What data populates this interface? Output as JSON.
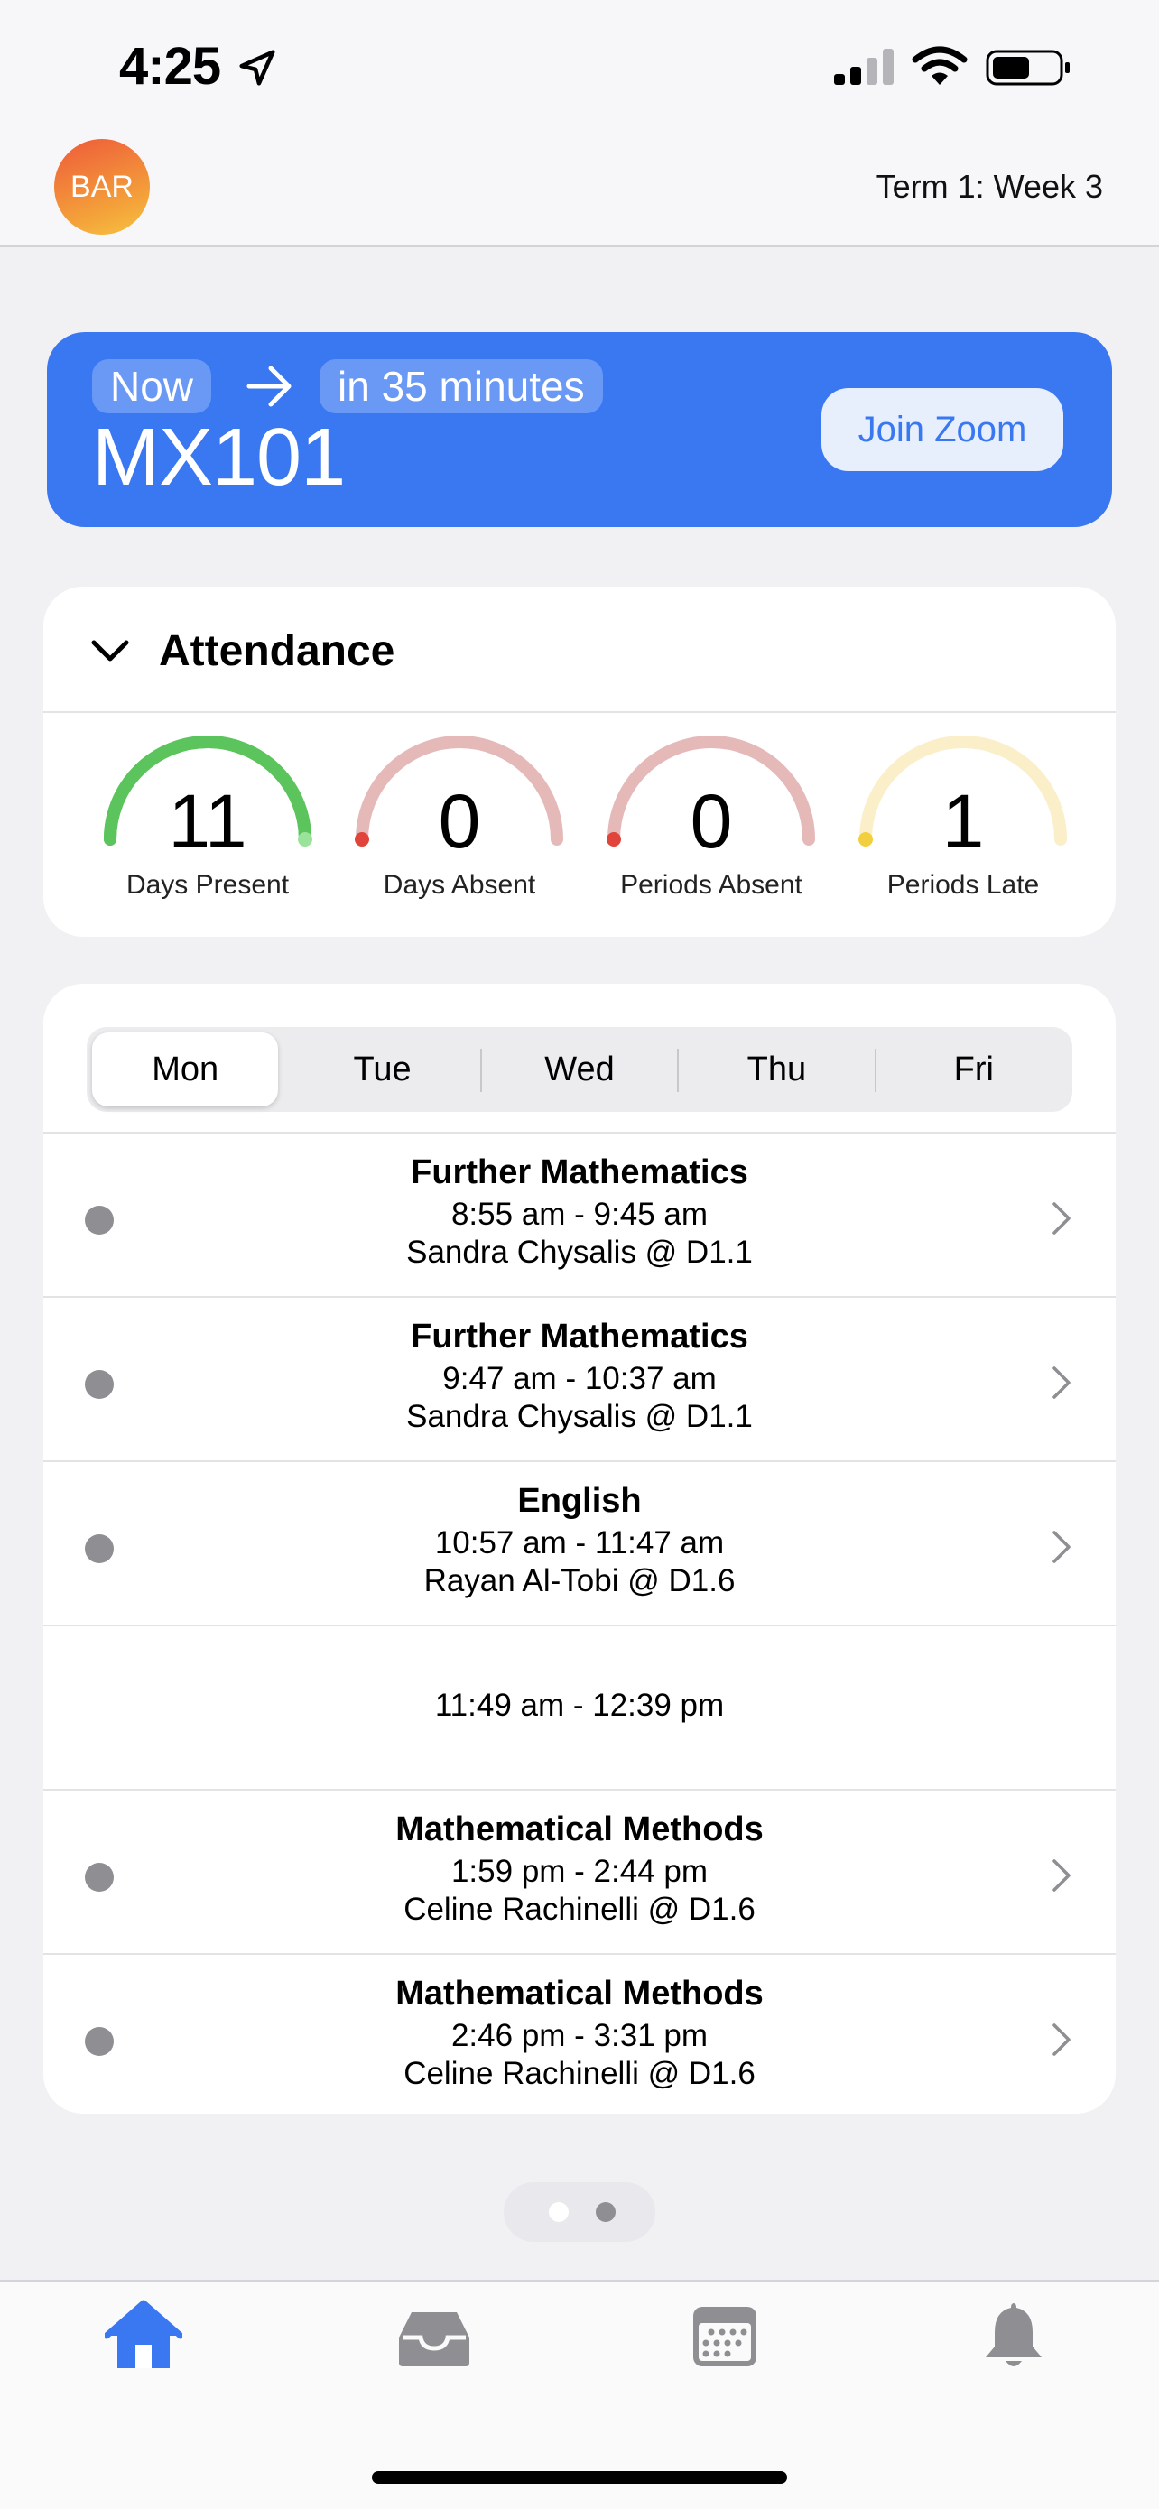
{
  "status_bar": {
    "time": "4:25"
  },
  "header": {
    "avatar_initials": "BAR",
    "term_label": "Term 1: Week 3"
  },
  "now_card": {
    "now_label": "Now",
    "next_label": "in 35 minutes",
    "course_code": "MX101",
    "join_button": "Join Zoom",
    "color": "#3a78f2"
  },
  "attendance": {
    "title": "Attendance",
    "stats": [
      {
        "value": "11",
        "label": "Days Present",
        "fill": 1.0,
        "color": "#5cc45c",
        "track": "#5cc45c"
      },
      {
        "value": "0",
        "label": "Days Absent",
        "fill": 0.0,
        "color": "#e0443a",
        "track": "#e6b9b9"
      },
      {
        "value": "0",
        "label": "Periods Absent",
        "fill": 0.0,
        "color": "#e0443a",
        "track": "#e6b9b9"
      },
      {
        "value": "1",
        "label": "Periods Late",
        "fill": 0.0,
        "color": "#f2cf3f",
        "track": "#fbefc9"
      }
    ]
  },
  "schedule": {
    "days": [
      "Mon",
      "Tue",
      "Wed",
      "Thu",
      "Fri"
    ],
    "selected_day": "Mon",
    "periods": [
      {
        "subject": "Further Mathematics",
        "time": "8:55 am - 9:45 am",
        "teacher_room": "Sandra Chysalis @ D1.1"
      },
      {
        "subject": "Further Mathematics",
        "time": "9:47 am - 10:37 am",
        "teacher_room": "Sandra Chysalis @ D1.1"
      },
      {
        "subject": "English",
        "time": "10:57 am - 11:47 am",
        "teacher_room": "Rayan Al-Tobi @ D1.6"
      },
      {
        "subject": "",
        "time": "11:49 am - 12:39 pm",
        "teacher_room": ""
      },
      {
        "subject": "Mathematical Methods",
        "time": "1:59 pm - 2:44 pm",
        "teacher_room": "Celine Rachinelli @ D1.6"
      },
      {
        "subject": "Mathematical Methods",
        "time": "2:46 pm - 3:31 pm",
        "teacher_room": "Celine Rachinelli @ D1.6"
      }
    ]
  },
  "pager": {
    "pages": 2,
    "current": 1
  },
  "tab_bar": {
    "items": [
      {
        "icon": "home-icon",
        "active": true
      },
      {
        "icon": "inbox-tray-icon",
        "active": false
      },
      {
        "icon": "calendar-icon",
        "active": false
      },
      {
        "icon": "bell-icon",
        "active": false
      }
    ],
    "active_color": "#3a78f2",
    "inactive_color": "#8e8e93"
  }
}
